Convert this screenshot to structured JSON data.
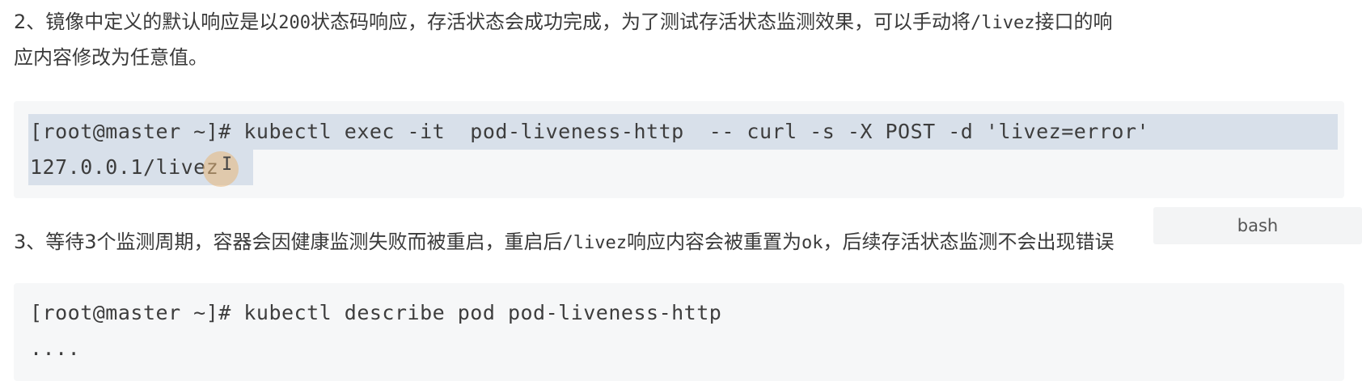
{
  "step2": {
    "line1_prefix": "2、镜像中定义的默认响应是以",
    "line1_code200": "200",
    "line1_mid": "状态码响应，存活状态会成功完成，为了测试存活状态监测效果，可以手动将",
    "line1_path": "/livez",
    "line1_suffix": "接口的响",
    "line2": "应内容修改为任意值。"
  },
  "code_block_1": {
    "line1": "[root@master ~]# kubectl exec -it  pod-liveness-http  -- curl -s -X POST -d 'livez=error'",
    "line2": "127.0.0.1/livez"
  },
  "lang_badge": "bash",
  "step3": {
    "prefix": "3、等待3个监测周期，容器会因健康监测失败而被重启，重启后",
    "path": "/livez",
    "mid": "响应内容会被重置为",
    "ok": "ok",
    "suffix": "，后续存活状态监测不会出现错误"
  },
  "code_block_2": {
    "line1": "[root@master ~]# kubectl describe pod pod-liveness-http",
    "line2": "...."
  }
}
